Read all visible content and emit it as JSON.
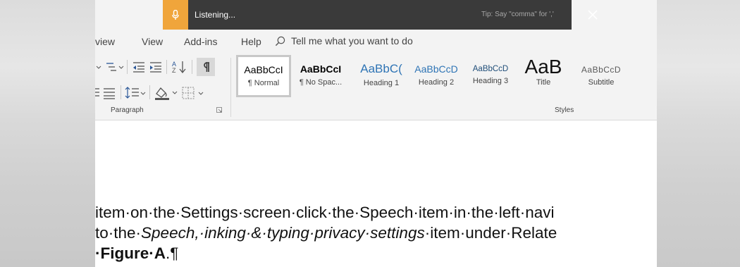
{
  "dictation": {
    "status": "Listening...",
    "tip": "Tip: Say \"comma\" for ','"
  },
  "tabs": {
    "review": "view",
    "view": "View",
    "addins": "Add-ins",
    "help": "Help"
  },
  "tell_me": {
    "text": "Tell me what you want to do"
  },
  "ribbon": {
    "paragraph_label": "Paragraph",
    "styles_label": "Styles",
    "styles": [
      {
        "preview": "AaBbCcI",
        "name": "¶ Normal"
      },
      {
        "preview": "AaBbCcI",
        "name": "¶ No Spac..."
      },
      {
        "preview": "AaBbC(",
        "name": "Heading 1"
      },
      {
        "preview": "AaBbCcD",
        "name": "Heading 2"
      },
      {
        "preview": "AaBbCcD",
        "name": "Heading 3"
      },
      {
        "preview": "AaB",
        "name": "Title"
      },
      {
        "preview": "AaBbCcD",
        "name": "Subtitle"
      }
    ]
  },
  "document": {
    "line1": "item·on·the·Settings·screen·click·the·Speech·item·in·the·left·navi",
    "line2_start": "to·the·",
    "line2_italic": "Speech,·inking·&·typing·privacy·settings",
    "line2_end": "·item·under·Relate",
    "line3_bold": "·Figure·A",
    "line3_end": ".¶"
  },
  "colors": {
    "accent_orange": "#f0a53b",
    "dictation_bg": "#3a3a3a",
    "heading_blue": "#2e74b5"
  }
}
